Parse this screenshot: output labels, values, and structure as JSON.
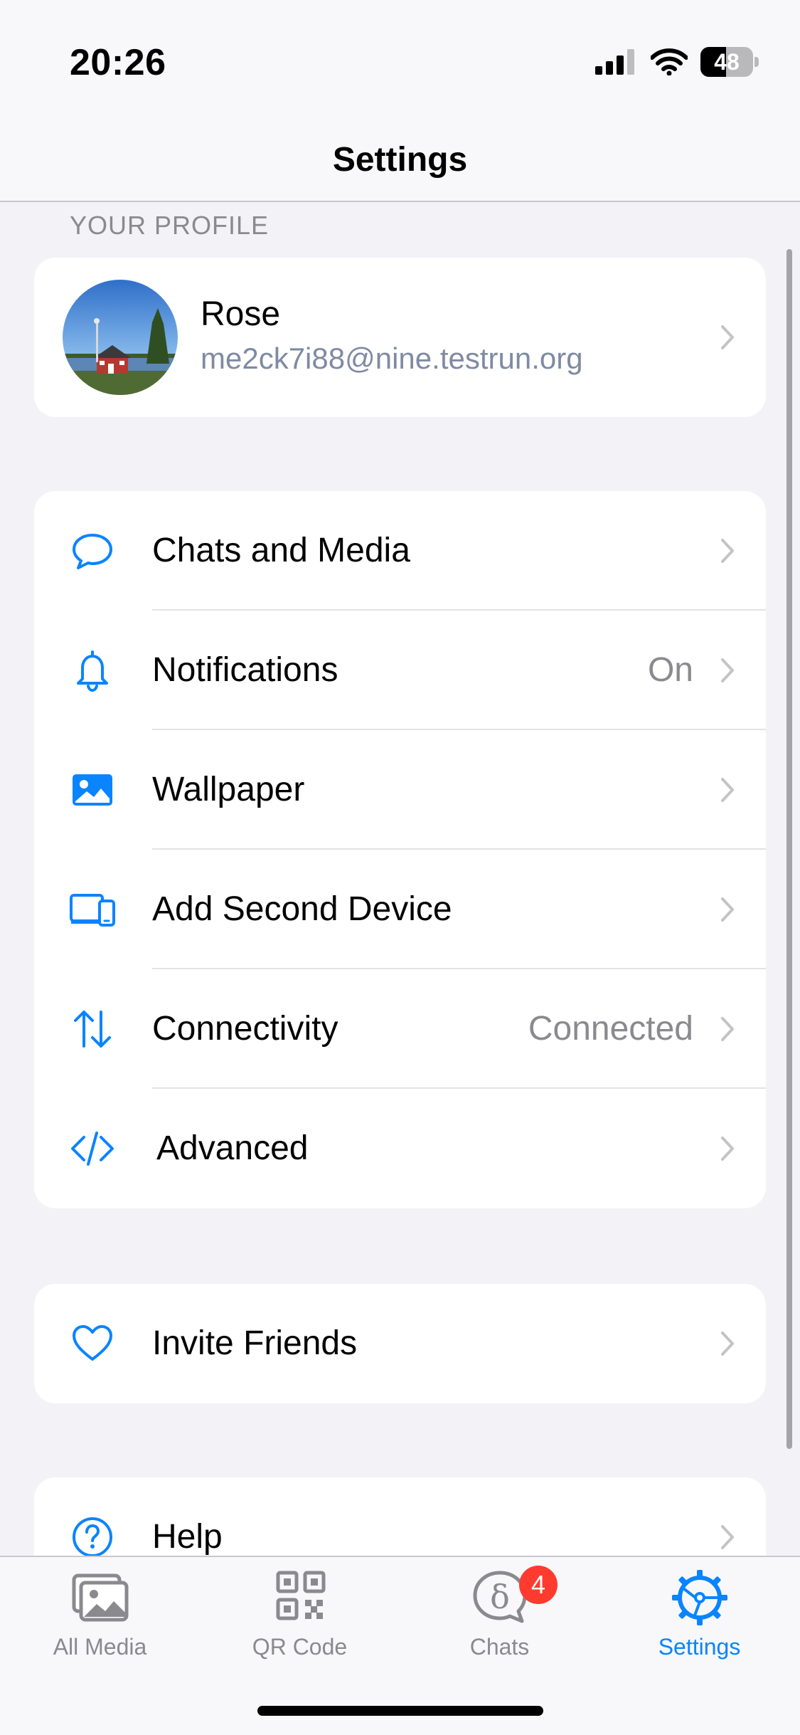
{
  "status_bar": {
    "time": "20:26",
    "battery": "48",
    "battery_level": 0.48
  },
  "nav": {
    "title": "Settings"
  },
  "profile_section": {
    "header": "YOUR PROFILE",
    "name": "Rose",
    "email": "me2ck7i88@nine.testrun.org"
  },
  "menu_group_1": [
    {
      "label": "Chats and Media",
      "detail": "",
      "icon": "chat-bubble-icon"
    },
    {
      "label": "Notifications",
      "detail": "On",
      "icon": "bell-icon"
    },
    {
      "label": "Wallpaper",
      "detail": "",
      "icon": "image-icon"
    },
    {
      "label": "Add Second Device",
      "detail": "",
      "icon": "devices-icon"
    },
    {
      "label": "Connectivity",
      "detail": "Connected",
      "icon": "arrows-updown-icon"
    },
    {
      "label": "Advanced",
      "detail": "",
      "icon": "code-icon"
    }
  ],
  "menu_group_2": [
    {
      "label": "Invite Friends",
      "icon": "heart-icon"
    }
  ],
  "menu_group_3": [
    {
      "label": "Help",
      "icon": "question-icon"
    }
  ],
  "tab_bar": {
    "tabs": [
      {
        "label": "All Media",
        "icon": "photos-icon",
        "active": false
      },
      {
        "label": "QR Code",
        "icon": "qr-code-icon",
        "active": false
      },
      {
        "label": "Chats",
        "icon": "delta-chat-icon",
        "active": false,
        "badge": "4"
      },
      {
        "label": "Settings",
        "icon": "settings-gear-icon",
        "active": true
      }
    ]
  },
  "colors": {
    "accent": "#0a84ff",
    "badge": "#ff3b30",
    "secondary_text": "#8a8a8e",
    "background": "#f2f2f7"
  }
}
